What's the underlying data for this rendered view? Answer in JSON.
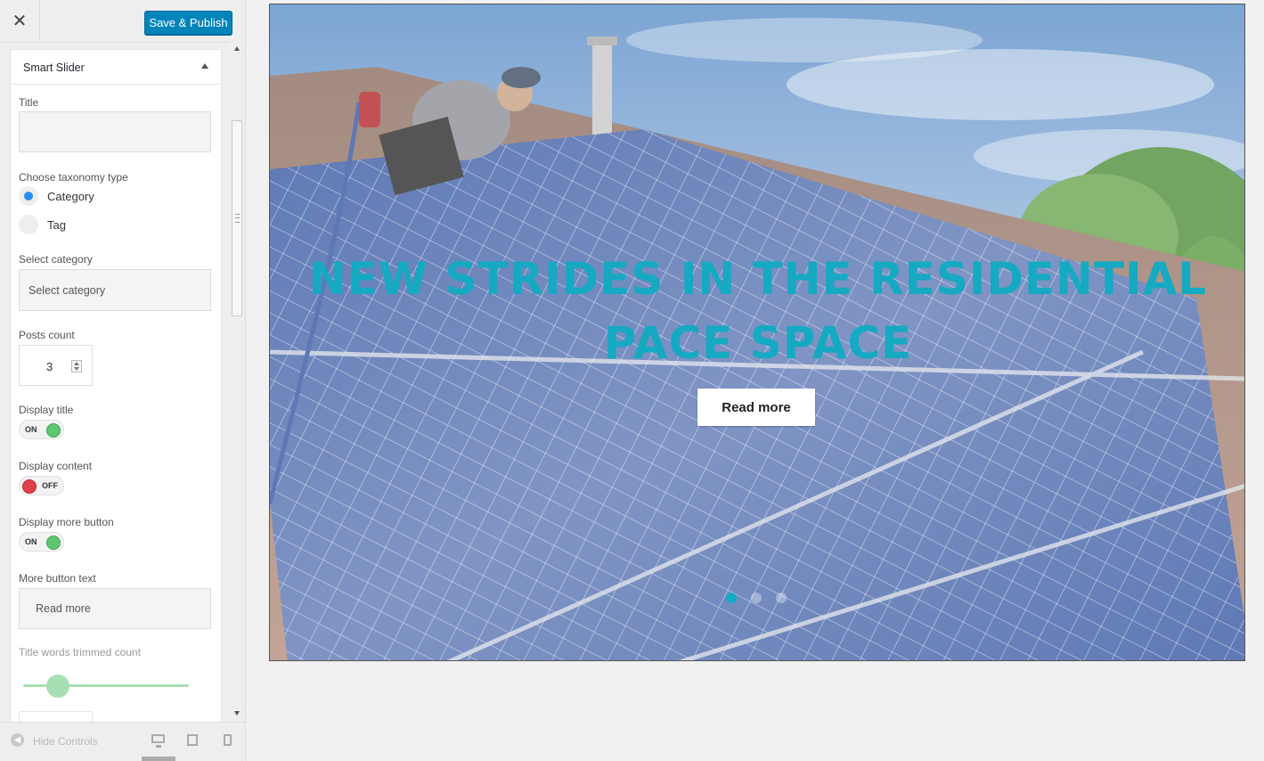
{
  "header": {
    "close_icon": "close-icon",
    "publish_label": "Save & Publish"
  },
  "section": {
    "title": "Smart Slider",
    "fields": {
      "title_label": "Title",
      "title_value": "",
      "taxonomy_label": "Choose taxonomy type",
      "taxonomy_options": [
        {
          "label": "Category",
          "selected": true
        },
        {
          "label": "Tag",
          "selected": false
        }
      ],
      "category_label": "Select category",
      "category_value": "Select category",
      "posts_count_label": "Posts count",
      "posts_count_value": "3",
      "display_title_label": "Display title",
      "display_title_state": "ON",
      "display_content_label": "Display content",
      "display_content_state": "OFF",
      "display_more_label": "Display more button",
      "display_more_state": "ON",
      "more_text_label": "More button text",
      "more_text_value": "Read more",
      "trim_label": "Title words trimmed count"
    }
  },
  "footer": {
    "hide_label": "Hide Controls",
    "devices": [
      "desktop",
      "tablet",
      "mobile"
    ],
    "active_device": "desktop"
  },
  "preview": {
    "slide_title": "NEW STRIDES IN THE RESIDENTIAL PACE SPACE",
    "button_label": "Read more",
    "dots": [
      {
        "active": true
      },
      {
        "active": false
      },
      {
        "active": false
      }
    ]
  },
  "colors": {
    "publish": "#0085ba",
    "accent_title": "#15a9c2",
    "toggle_on": "#5fc572",
    "toggle_off": "#e0404a",
    "radio": "#2a8df0"
  }
}
